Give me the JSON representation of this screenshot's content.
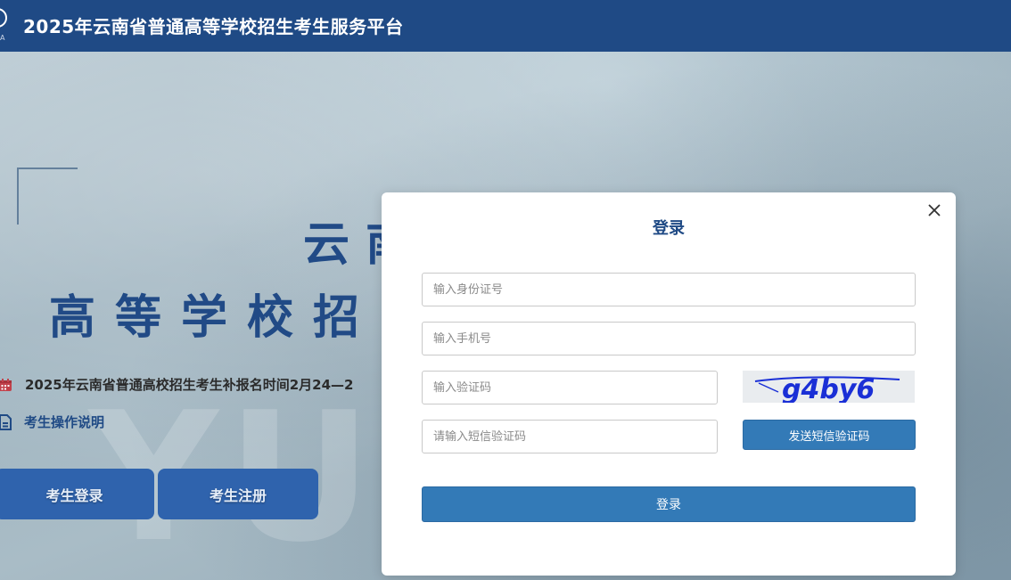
{
  "header": {
    "title": "2025年云南省普通高等学校招生考生服务平台",
    "logo_icon": "university-seal-icon",
    "logo_sub": "A"
  },
  "hero": {
    "line1": "云南",
    "line2": "高等学校招",
    "watermark": "YUN"
  },
  "notice": {
    "icon": "calendar-icon",
    "text": "2025年云南省普通高校招生考生补报名时间2月24—2"
  },
  "guide": {
    "icon": "document-icon",
    "text": "考生操作说明"
  },
  "buttons": {
    "login": "考生登录",
    "register": "考生注册"
  },
  "modal": {
    "title": "登录",
    "close_icon": "close-icon",
    "id_placeholder": "输入身份证号",
    "phone_placeholder": "输入手机号",
    "captcha_placeholder": "输入验证码",
    "captcha_text": "g4by6",
    "sms_placeholder": "请输入短信验证码",
    "sms_button": "发送短信验证码",
    "submit": "登录"
  },
  "colors": {
    "header_bg": "#1f4a85",
    "primary_button": "#337ab7",
    "hero_text": "#214a86",
    "captcha_ink": "#1a2fd6"
  }
}
